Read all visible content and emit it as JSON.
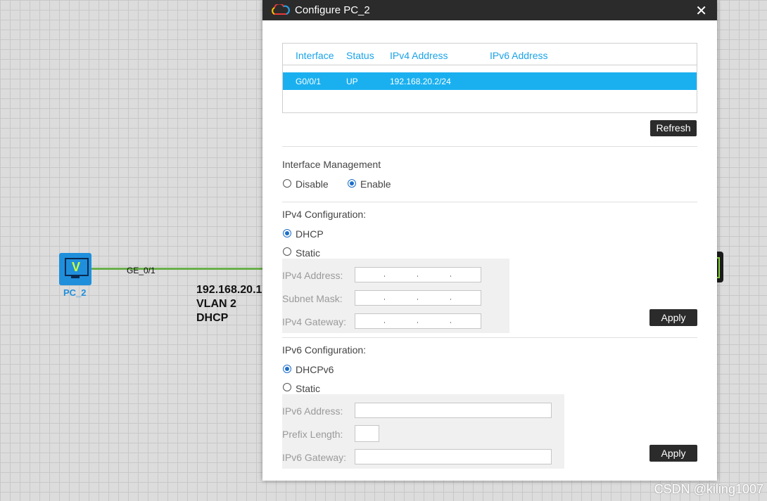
{
  "canvas": {
    "pc_label": "PC_2",
    "port_label": "GE_0/1",
    "info_lines": [
      "192.168.20.1",
      "VLAN 2",
      "DHCP"
    ],
    "pc_icon": "monitor-icon",
    "pc_icon_glyph": "V"
  },
  "watermark": "CSDN @kiling1007",
  "dialog": {
    "title": "Configure PC_2",
    "title_icon": "cloud-icon",
    "close_glyph": "✕",
    "table": {
      "headers": [
        "Interface",
        "Status",
        "IPv4 Address",
        "IPv6 Address"
      ],
      "rows": [
        {
          "interface": "G0/0/1",
          "status": "UP",
          "ipv4": "192.168.20.2/24",
          "ipv6": ""
        }
      ]
    },
    "refresh_label": "Refresh",
    "interface_mgmt": {
      "label": "Interface Management",
      "options": [
        "Disable",
        "Enable"
      ],
      "selected": "Enable"
    },
    "ipv4": {
      "label": "IPv4 Configuration:",
      "options": [
        "DHCP",
        "Static"
      ],
      "selected": "DHCP",
      "fields": [
        "IPv4 Address:",
        "Subnet Mask:",
        "IPv4 Gateway:"
      ],
      "apply_label": "Apply"
    },
    "ipv6": {
      "label": "IPv6 Configuration:",
      "options": [
        "DHCPv6",
        "Static"
      ],
      "selected": "DHCPv6",
      "fields": [
        "IPv6 Address:",
        "Prefix Length:",
        "IPv6 Gateway:"
      ],
      "apply_label": "Apply"
    }
  },
  "colors": {
    "accent": "#1ab0f0",
    "header_text": "#1aa3e8",
    "dark": "#2b2b2b",
    "link": "#6ab04c"
  }
}
